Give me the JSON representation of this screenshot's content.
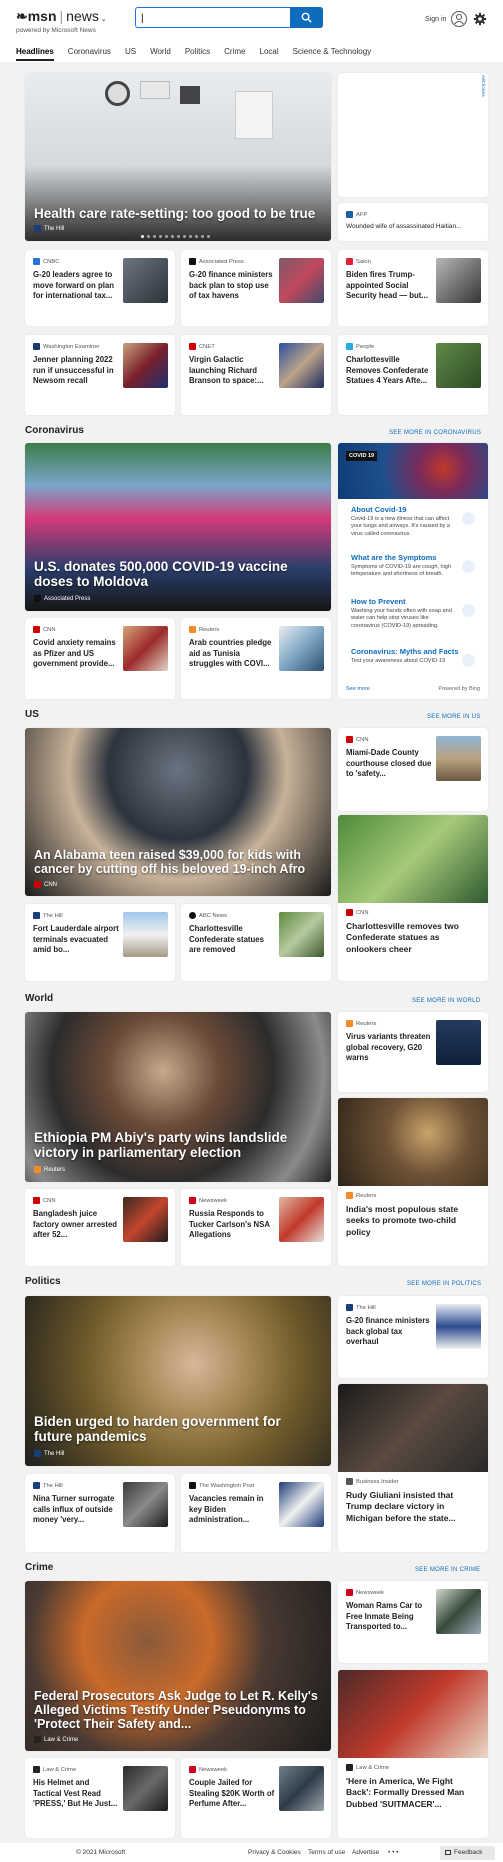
{
  "header": {
    "logo_brand": "msn",
    "logo_section": "news",
    "powered": "powered by Microsoft News",
    "search_value": "|",
    "signin": "Sign in"
  },
  "nav": [
    "Headlines",
    "Coronavirus",
    "US",
    "World",
    "Politics",
    "Crime",
    "Local",
    "Science & Technology"
  ],
  "top": {
    "hero": {
      "title": "Health care rate-setting: too good to be true",
      "source": "The Hill"
    },
    "ad_label": "AdChoices",
    "side": {
      "source": "AFP",
      "title": "Wounded wife of assassinated Haitian..."
    },
    "row1": [
      {
        "source": "CNBC",
        "title": "G-20 leaders agree to move forward on plan for international tax..."
      },
      {
        "source": "Associated Press",
        "title": "G-20 finance ministers back plan to stop use of tax havens"
      },
      {
        "source": "Salon",
        "title": "Biden fires Trump-appointed Social Security head — but..."
      }
    ],
    "row2": [
      {
        "source": "Washington Examiner",
        "title": "Jenner planning 2022 run if unsuccessful in Newsom recall"
      },
      {
        "source": "CNET",
        "title": "Virgin Galactic launching Richard Branson to space:..."
      },
      {
        "source": "People",
        "title": "Charlottesville Removes Confederate Statues 4 Years Afte..."
      }
    ]
  },
  "coronavirus": {
    "title": "Coronavirus",
    "see_more": "SEE MORE IN CORONAVIRUS",
    "hero": {
      "title": "U.S. donates 500,000 COVID-19 vaccine doses to Moldova",
      "source": "Associated Press"
    },
    "cards": [
      {
        "source": "CNN",
        "title": "Covid anxiety remains as Pfizer and US government provide..."
      },
      {
        "source": "Reuters",
        "title": "Arab countries pledge aid as Tunisia struggles with COVI..."
      }
    ],
    "panel": {
      "badge": "COVID 19",
      "items": [
        {
          "h": "About Covid-19",
          "d": "Covid-19 is a new illness that can affect your lungs and airways. It's caused by a virus called coronavirus."
        },
        {
          "h": "What are the Symptoms",
          "d": "Symptoms of COVID-19 are cough, high temperature and shortness of breath."
        },
        {
          "h": "How to Prevent",
          "d": "Washing your hands often with soap and water can help stop viruses like coronavirus (COVID-19) spreading."
        },
        {
          "h": "Coronavirus: Myths and Facts",
          "d": "Test your awareness about COVID-19"
        }
      ],
      "see_more": "See more",
      "powered": "Powered by Bing"
    }
  },
  "us": {
    "title": "US",
    "see_more": "SEE MORE IN US",
    "hero": {
      "title": "An Alabama teen raised $39,000 for kids with cancer by cutting off his beloved 19-inch Afro",
      "source": "CNN"
    },
    "side1": {
      "source": "CNN",
      "title": "Miami-Dade County courthouse closed due to 'safety..."
    },
    "side2": {
      "source": "CNN",
      "title": "Charlottesville removes two Confederate statues as onlookers cheer"
    },
    "cards": [
      {
        "source": "The Hill",
        "title": "Fort Lauderdale airport terminals evacuated amid bo..."
      },
      {
        "source": "ABC News",
        "title": "Charlottesville Confederate statues are removed"
      }
    ]
  },
  "world": {
    "title": "World",
    "see_more": "SEE MORE IN WORLD",
    "hero": {
      "title": "Ethiopia PM Abiy's party wins landslide victory in parliamentary election",
      "source": "Reuters"
    },
    "side1": {
      "source": "Reuters",
      "title": "Virus variants threaten global recovery, G20 warns"
    },
    "side2": {
      "source": "Reuters",
      "title": "India's most populous state seeks to promote two-child policy"
    },
    "cards": [
      {
        "source": "CNN",
        "title": "Bangladesh juice factory owner arrested after 52..."
      },
      {
        "source": "Newsweek",
        "title": "Russia Responds to Tucker Carlson's NSA Allegations"
      }
    ]
  },
  "politics": {
    "title": "Politics",
    "see_more": "SEE MORE IN POLITICS",
    "hero": {
      "title": "Biden urged to harden government for future pandemics",
      "source": "The Hill"
    },
    "side1": {
      "source": "The Hill",
      "title": "G-20 finance ministers back global tax overhaul"
    },
    "side2": {
      "source": "Business Insider",
      "title": "Rudy Giuliani insisted that Trump declare victory in Michigan before the state..."
    },
    "cards": [
      {
        "source": "The Hill",
        "title": "Nina Turner surrogate calls influx of outside money 'very..."
      },
      {
        "source": "The Washington Post",
        "title": "Vacancies remain in key Biden administration..."
      }
    ]
  },
  "crime": {
    "title": "Crime",
    "see_more": "SEE MORE IN CRIME",
    "hero": {
      "title": "Federal Prosecutors Ask Judge to Let R. Kelly's Alleged Victims Testify Under Pseudonyms to 'Protect Their Safety and...",
      "source": "Law & Crime"
    },
    "side1": {
      "source": "Newsweek",
      "title": "Woman Rams Car to Free Inmate Being Transported to..."
    },
    "side2": {
      "source": "Law & Crime",
      "title": "'Here in America, We Fight Back': Formally Dressed Man Dubbed 'SUITMACER'..."
    },
    "cards": [
      {
        "source": "Law & Crime",
        "title": "His Helmet and Tactical Vest Read 'PRESS,' But He Just..."
      },
      {
        "source": "Newsweek",
        "title": "Couple Jailed for Stealing $20K Worth of Perfume After..."
      }
    ]
  },
  "footer": {
    "copyright": "© 2021 Microsoft",
    "links": [
      "Privacy & Cookies",
      "Terms of use",
      "Advertise"
    ],
    "more": "• • •",
    "feedback": "Feedback"
  }
}
